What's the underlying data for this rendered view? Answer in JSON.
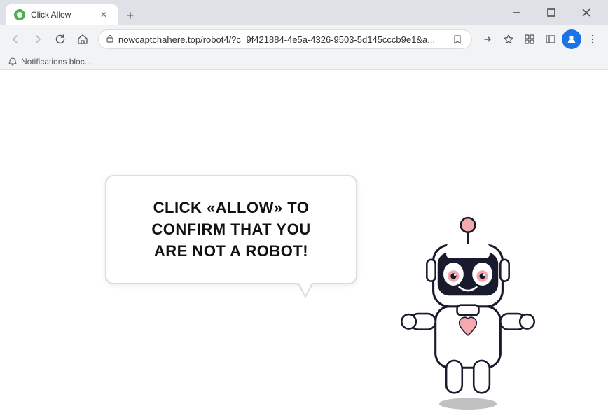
{
  "browser": {
    "tab": {
      "title": "Click Allow",
      "favicon_color": "#4CAF50"
    },
    "new_tab_label": "+",
    "window_controls": {
      "minimize": "−",
      "maximize": "□",
      "close": "✕"
    },
    "address_bar": {
      "url": "nowcaptchahere.top/robot4/?c=9f421884-4e5a-4326-9503-5d145cccb9e1&a...",
      "lock_icon": "🔒"
    },
    "notifications_label": "Notifications bloc..."
  },
  "page": {
    "bubble_text": "CLICK «ALLOW» TO CONFIRM THAT YOU ARE NOT A ROBOT!"
  }
}
